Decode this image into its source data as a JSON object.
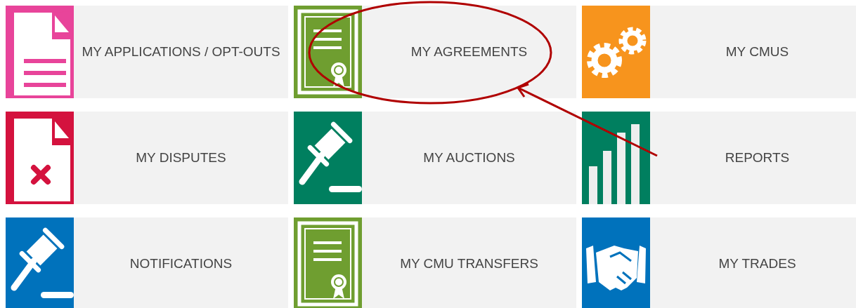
{
  "tiles": [
    {
      "label": "MY APPLICATIONS / OPT-OUTS",
      "kind": "document",
      "color": "#e8449a"
    },
    {
      "label": "MY AGREEMENTS",
      "kind": "certificate",
      "color": "#6f9e30"
    },
    {
      "label": "MY CMUS",
      "kind": "gears",
      "color": "#f7941d"
    },
    {
      "label": "MY DISPUTES",
      "kind": "dispute",
      "color": "#d4123e"
    },
    {
      "label": "MY AUCTIONS",
      "kind": "gavel",
      "color": "#007f5f"
    },
    {
      "label": "REPORTS",
      "kind": "chart",
      "color": "#007f5f"
    },
    {
      "label": "NOTIFICATIONS",
      "kind": "gavel",
      "color": "#0072bc"
    },
    {
      "label": "MY CMU TRANSFERS",
      "kind": "certificate",
      "color": "#6f9e30"
    },
    {
      "label": "MY TRADES",
      "kind": "handshake",
      "color": "#0072bc"
    }
  ],
  "annotation": {
    "kind": "circle-and-arrow"
  }
}
